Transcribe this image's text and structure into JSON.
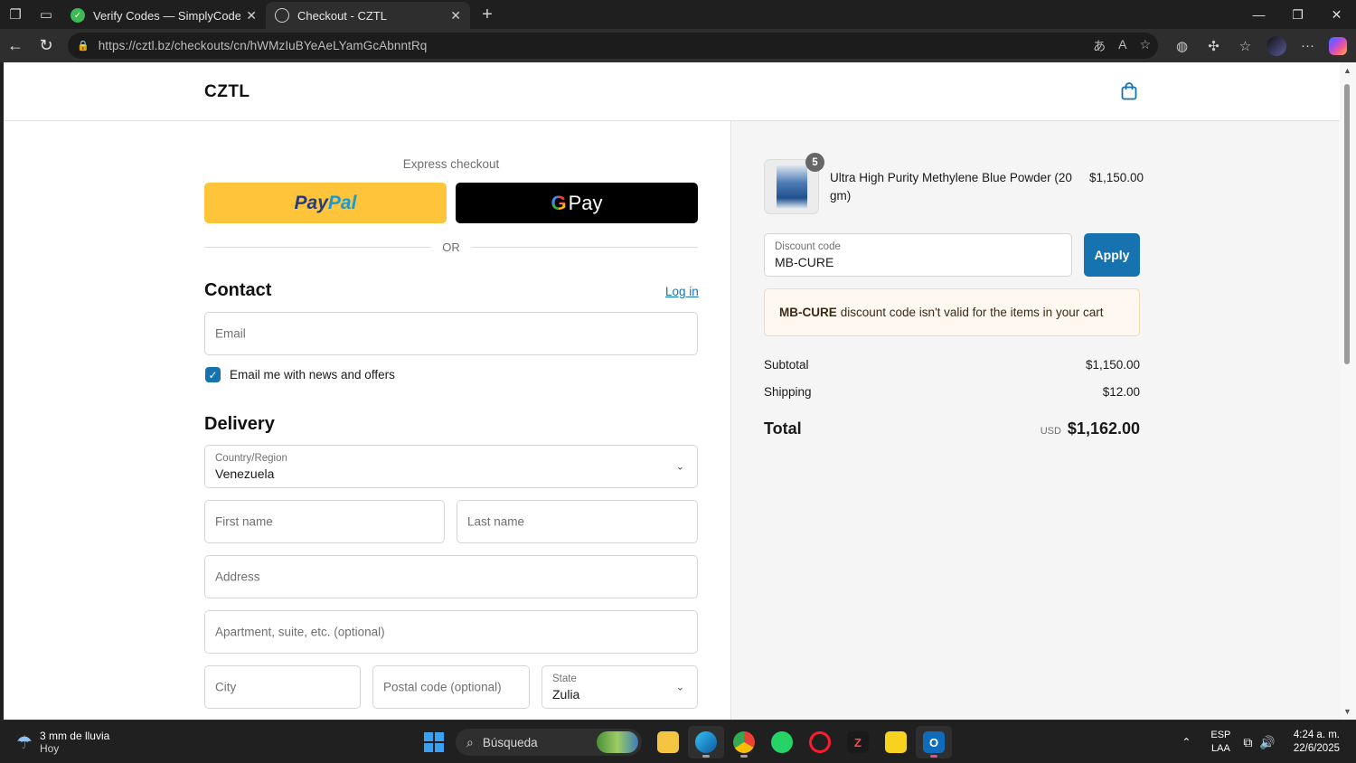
{
  "browser": {
    "tabs": [
      {
        "title": "Verify Codes — SimplyCodes",
        "icon": "simplycodes-icon",
        "active": false
      },
      {
        "title": "Checkout - CZTL",
        "icon": "globe-icon",
        "active": true
      }
    ],
    "url": "https://cztl.bz/checkouts/cn/hWMzIuBYeAeLYamGcAbnntRq"
  },
  "header": {
    "brand": "CZTL"
  },
  "express": {
    "label": "Express checkout",
    "paypal_part1": "Pay",
    "paypal_part2": "Pal",
    "gpay_g": "G",
    "gpay_label": "Pay",
    "or": "OR"
  },
  "contact": {
    "title": "Contact",
    "login": "Log in",
    "email_placeholder": "Email",
    "newsletter_label": "Email me with news and offers",
    "newsletter_checked": true
  },
  "delivery": {
    "title": "Delivery",
    "country_label": "Country/Region",
    "country_value": "Venezuela",
    "first_name_placeholder": "First name",
    "last_name_placeholder": "Last name",
    "address_placeholder": "Address",
    "apartment_placeholder": "Apartment, suite, etc. (optional)",
    "city_placeholder": "City",
    "postal_placeholder": "Postal code (optional)",
    "state_label": "State",
    "state_value": "Zulia"
  },
  "summary": {
    "product": {
      "name": "Ultra High Purity Methylene Blue Powder (20 gm)",
      "price": "$1,150.00",
      "quantity": "5"
    },
    "discount_label": "Discount code",
    "discount_value": "MB-CURE",
    "apply": "Apply",
    "error_code": "MB-CURE",
    "error_text": "discount code isn't valid for the items in your cart",
    "subtotal_label": "Subtotal",
    "subtotal_value": "$1,150.00",
    "shipping_label": "Shipping",
    "shipping_value": "$12.00",
    "total_label": "Total",
    "total_currency": "USD",
    "total_value": "$1,162.00"
  },
  "taskbar": {
    "weather_line1": "3 mm de lluvia",
    "weather_line2": "Hoy",
    "search": "Búsqueda",
    "lang1": "ESP",
    "lang2": "LAA",
    "time": "4:24 a. m.",
    "date": "22/6/2025"
  },
  "colors": {
    "accent": "#1773b0",
    "paypal_yellow": "#ffc439",
    "alert_bg": "#fff8f1"
  }
}
